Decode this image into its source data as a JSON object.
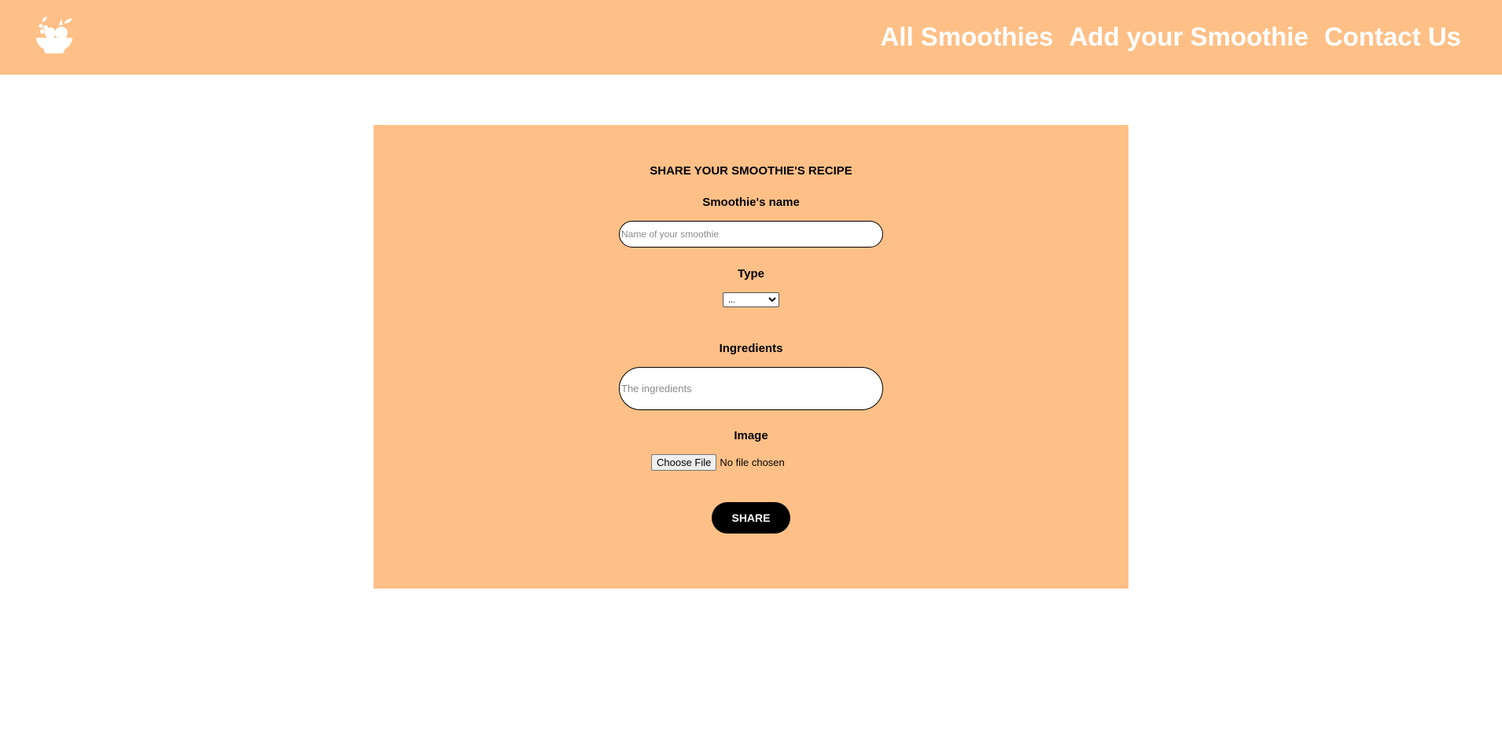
{
  "header": {
    "logo_icon": "fruit-bowl-icon",
    "nav": [
      {
        "label": "All Smoothies"
      },
      {
        "label": "Add your Smoothie"
      },
      {
        "label": "Contact Us"
      }
    ]
  },
  "form": {
    "title": "SHARE YOUR SMOOTHIE'S RECIPE",
    "name_label": "Smoothie's name",
    "name_placeholder": "Name of your smoothie",
    "name_value": "",
    "type_label": "Type",
    "type_selected": "...",
    "ingredients_label": "Ingredients",
    "ingredients_placeholder": "The ingredients",
    "ingredients_value": "",
    "image_label": "Image",
    "file_button": "Choose File",
    "file_status": "No file chosen",
    "submit_label": "SHARE"
  },
  "colors": {
    "accent": "#ffc087",
    "button": "#000000",
    "nav_text": "#ffffff"
  }
}
